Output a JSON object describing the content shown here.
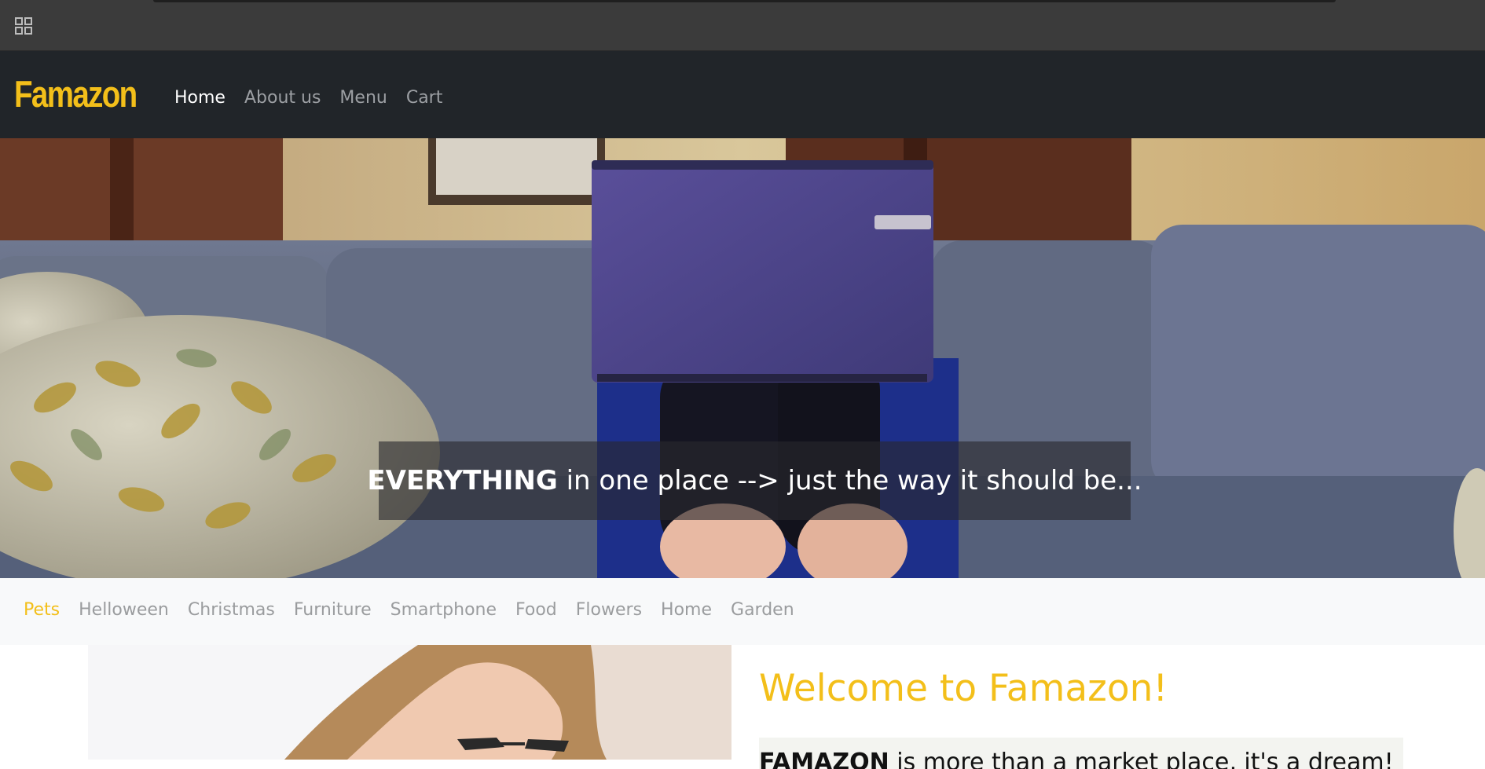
{
  "navbar": {
    "brand": "Famazon",
    "links": [
      {
        "label": "Home",
        "active": true
      },
      {
        "label": "About us",
        "active": false
      },
      {
        "label": "Menu",
        "active": false
      },
      {
        "label": "Cart",
        "active": false
      }
    ]
  },
  "hero": {
    "caption_bold": "EVERYTHING",
    "caption_rest": " in one place --> just the way it should be..."
  },
  "categories": [
    "Pets",
    "Helloween",
    "Christmas",
    "Furniture",
    "Smartphone",
    "Food",
    "Flowers",
    "Home",
    "Garden"
  ],
  "active_category": "Pets",
  "welcome": {
    "title": "Welcome to Famazon!",
    "intro_bold": "FAMAZON",
    "intro_rest": " is more than a market place, it's a dream!"
  },
  "icons": {
    "apps": "apps-grid-icon"
  },
  "colors": {
    "accent": "#f3bf1a",
    "navbar_bg": "#212529",
    "appbar_bg": "#3b3b3b",
    "catbar_bg": "#f8f9fa"
  }
}
